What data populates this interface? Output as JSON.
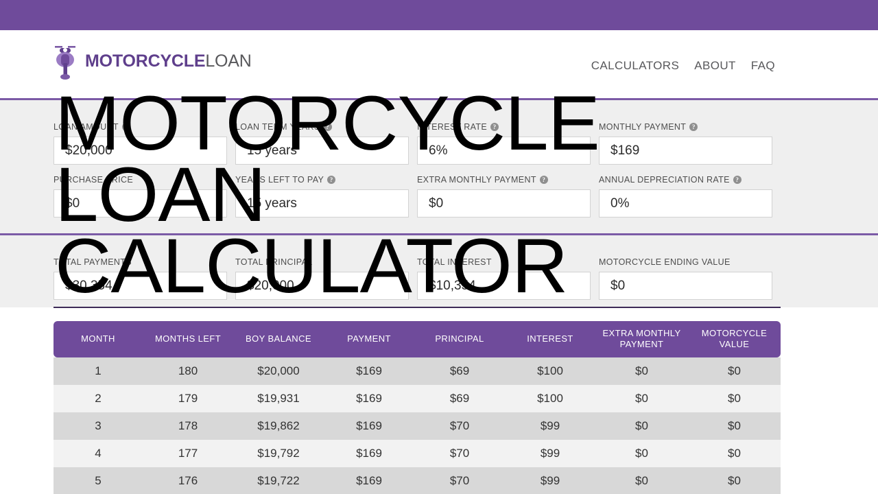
{
  "brand": {
    "name_bold": "MOTORCYCLE",
    "name_light": "LOAN",
    "logo_icon": "motorcycle-icon",
    "accent_color": "#6f4b9b",
    "secondary_color": "#58585b"
  },
  "nav": {
    "items": [
      {
        "label": "CALCULATORS"
      },
      {
        "label": "ABOUT"
      },
      {
        "label": "FAQ"
      }
    ]
  },
  "overlay_title": {
    "line1": "MOTORCYCLE",
    "line2": "LOAN",
    "line3": "CALCULATOR"
  },
  "inputs": {
    "row1": [
      {
        "label": "LOAN AMOUNT",
        "help": true,
        "value": "$20,000",
        "name": "loan-amount"
      },
      {
        "label": "LOAN TERM YEARS",
        "help": true,
        "value": "15 years",
        "name": "loan-term-years"
      },
      {
        "label": "INTEREST RATE",
        "help": true,
        "value": "6%",
        "name": "interest-rate"
      },
      {
        "label": "MONTHLY PAYMENT",
        "help": true,
        "value": "$169",
        "name": "monthly-payment"
      }
    ],
    "row2": [
      {
        "label": "PURCHASE PRICE",
        "help": false,
        "value": "$0",
        "name": "purchase-price"
      },
      {
        "label": "YEARS LEFT TO PAY",
        "help": true,
        "value": "15 years",
        "name": "years-left-to-pay"
      },
      {
        "label": "EXTRA MONTHLY PAYMENT",
        "help": true,
        "value": "$0",
        "name": "extra-monthly-payment"
      },
      {
        "label": "ANNUAL DEPRECIATION RATE",
        "help": true,
        "value": "0%",
        "name": "annual-depreciation-rate"
      }
    ]
  },
  "results": [
    {
      "label": "TOTAL PAYMENTS",
      "value": "$30,354",
      "name": "total-payments"
    },
    {
      "label": "TOTAL PRINCIPAL",
      "value": "$20,000",
      "name": "total-principal"
    },
    {
      "label": "TOTAL INTEREST",
      "value": "$10,354",
      "name": "total-interest"
    },
    {
      "label": "MOTORCYCLE ENDING VALUE",
      "value": "$0",
      "name": "motorcycle-ending-value"
    }
  ],
  "table": {
    "headers": [
      "MONTH",
      "MONTHS LEFT",
      "BOY BALANCE",
      "PAYMENT",
      "PRINCIPAL",
      "INTEREST",
      "EXTRA MONTHLY PAYMENT",
      "MOTORCYCLE VALUE"
    ],
    "rows": [
      [
        "1",
        "180",
        "$20,000",
        "$169",
        "$69",
        "$100",
        "$0",
        "$0"
      ],
      [
        "2",
        "179",
        "$19,931",
        "$169",
        "$69",
        "$100",
        "$0",
        "$0"
      ],
      [
        "3",
        "178",
        "$19,862",
        "$169",
        "$70",
        "$99",
        "$0",
        "$0"
      ],
      [
        "4",
        "177",
        "$19,792",
        "$169",
        "$70",
        "$99",
        "$0",
        "$0"
      ],
      [
        "5",
        "176",
        "$19,722",
        "$169",
        "$70",
        "$99",
        "$0",
        "$0"
      ]
    ]
  }
}
